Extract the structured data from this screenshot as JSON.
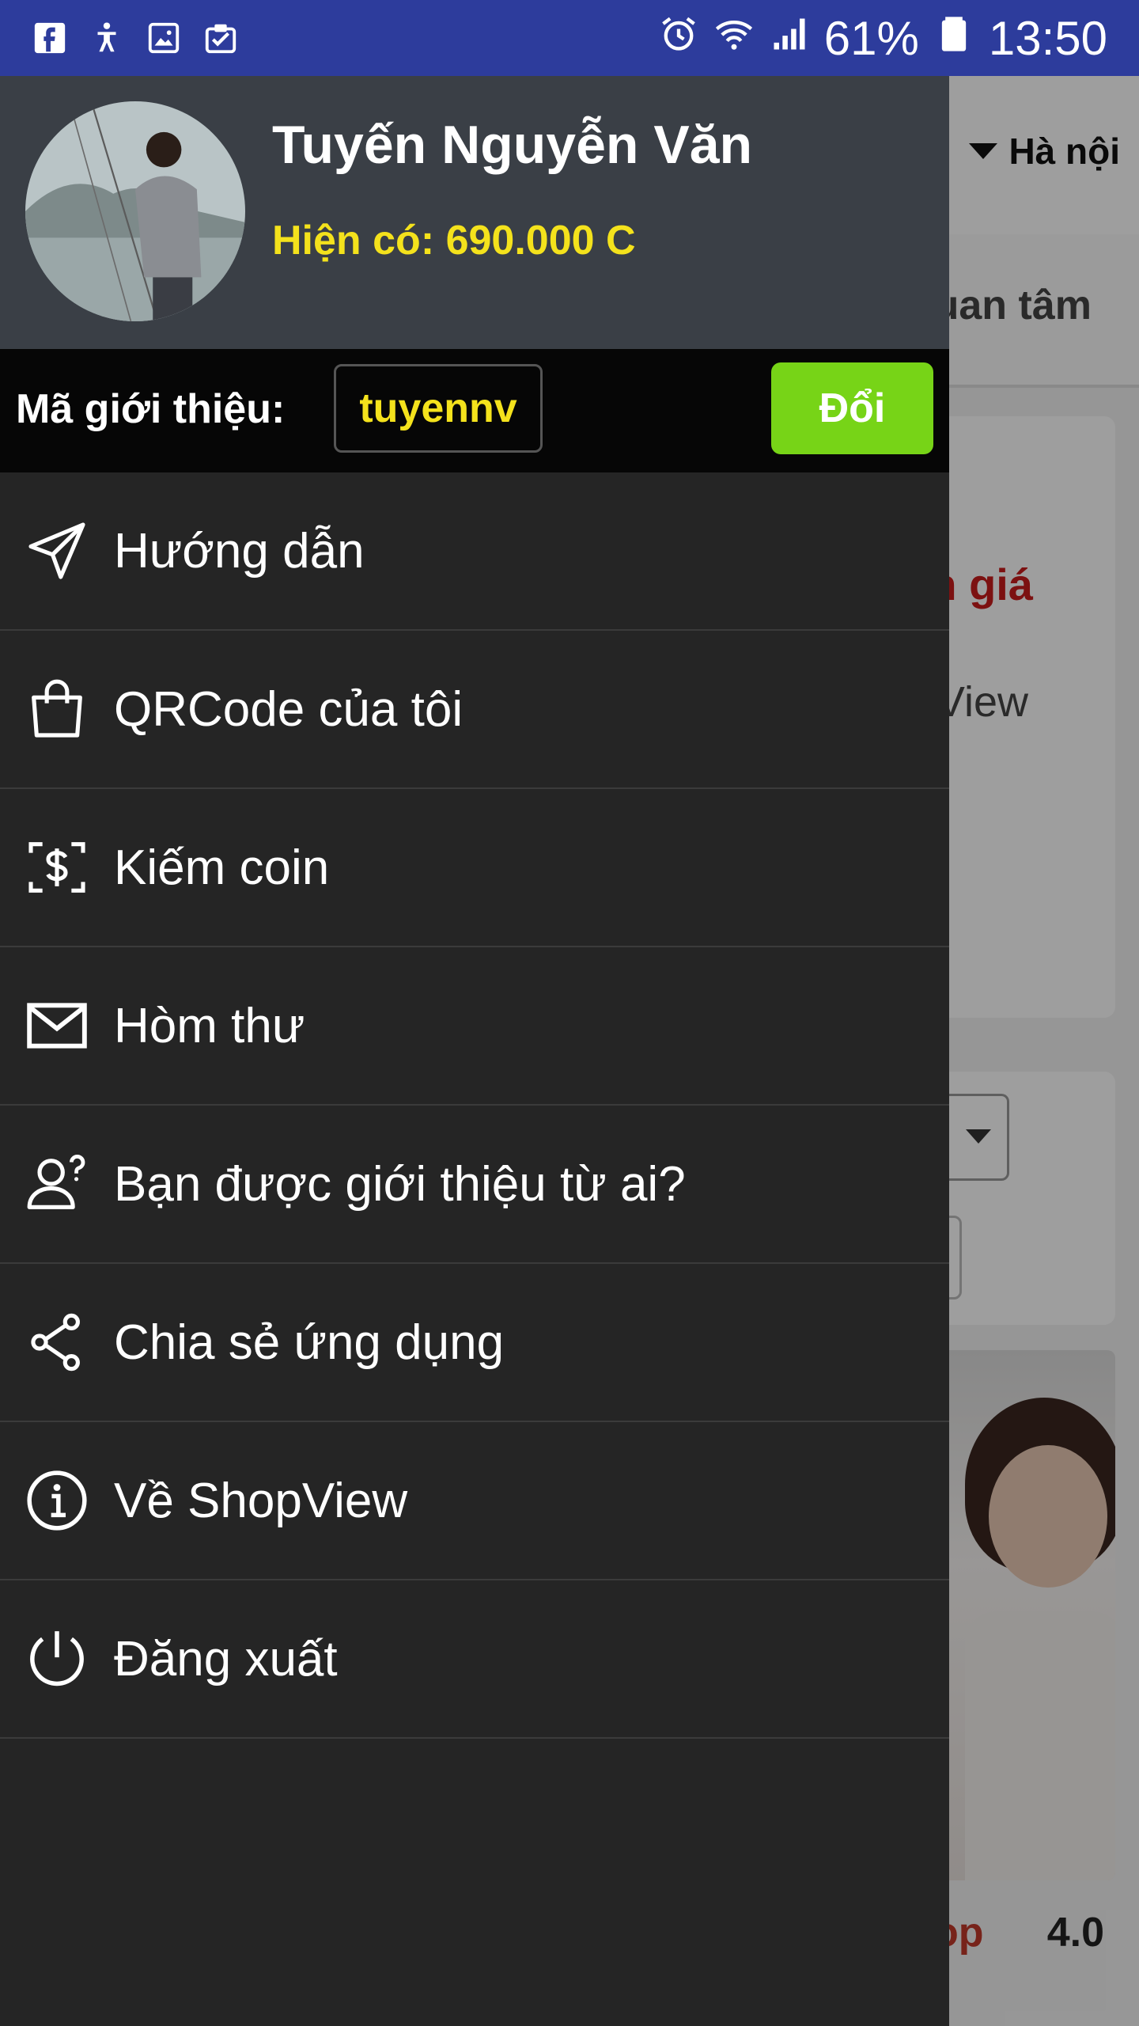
{
  "status_bar": {
    "battery": "61%",
    "time": "13:50",
    "icons": [
      "facebook-icon",
      "accessibility-icon",
      "image-icon",
      "clipboard-check-icon",
      "alarm-icon",
      "wifi-icon",
      "signal-icon",
      "battery-icon"
    ]
  },
  "background": {
    "city": "Hà nội",
    "tab_label": "uan tâm",
    "red_text": "n giá",
    "gray_text": "View",
    "bottom_text": "op",
    "rating": "4.0"
  },
  "drawer": {
    "user_name": "Tuyến Nguyễn Văn",
    "balance": "Hiện có: 690.000 C",
    "referral_label": "Mã giới thiệu:",
    "referral_code": "tuyennv",
    "change_button": "Đổi",
    "menu": [
      {
        "label": "Hướng dẫn",
        "icon": "navigation-icon"
      },
      {
        "label": "QRCode của tôi",
        "icon": "shopping-bag-icon"
      },
      {
        "label": "Kiếm coin",
        "icon": "dollar-scan-icon"
      },
      {
        "label": "Hòm thư",
        "icon": "mail-icon"
      },
      {
        "label": "Bạn được giới thiệu từ ai?",
        "icon": "user-question-icon"
      },
      {
        "label": "Chia sẻ ứng dụng",
        "icon": "share-icon"
      },
      {
        "label": "Về ShopView",
        "icon": "info-icon"
      },
      {
        "label": "Đăng xuất",
        "icon": "power-icon"
      }
    ]
  },
  "colors": {
    "status_bar": "#2d3c9c",
    "header_bg": "#3a3f46",
    "drawer_bg": "#252525",
    "accent_yellow": "#f4e21c",
    "button_green": "#77d417"
  }
}
